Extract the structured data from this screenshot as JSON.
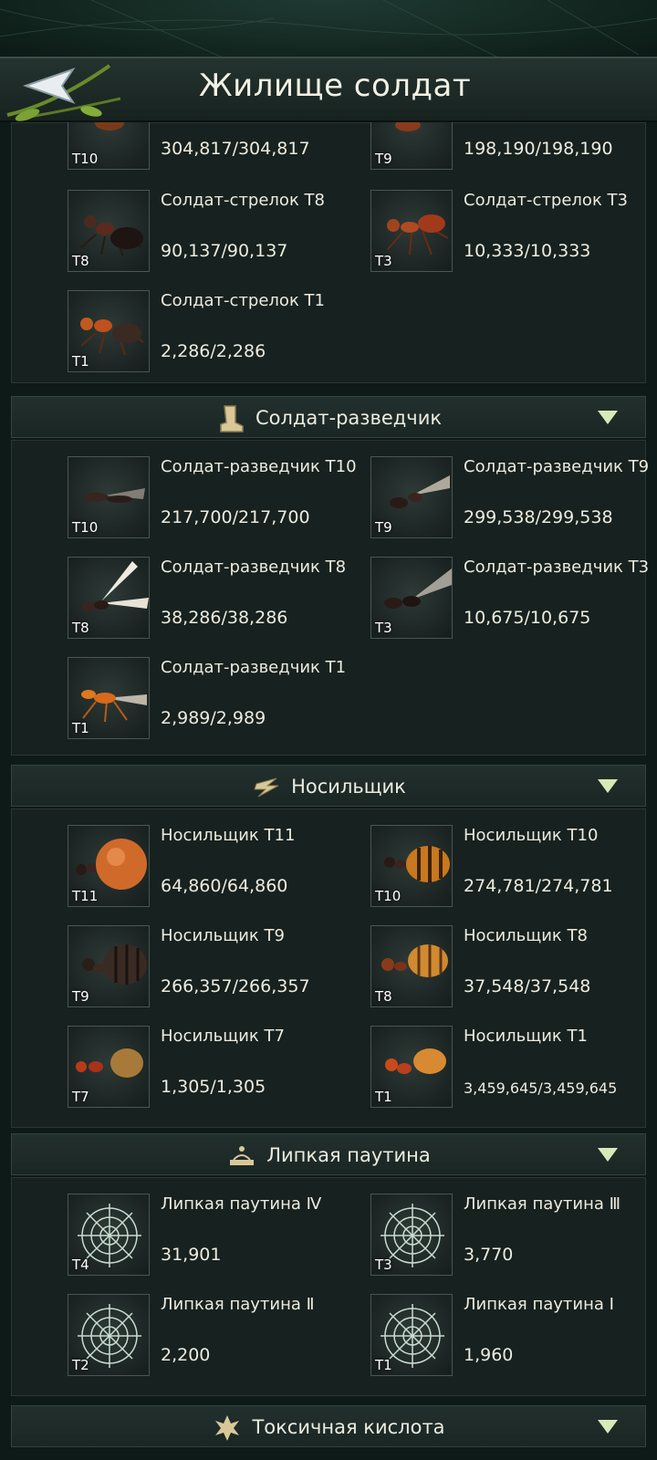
{
  "header": {
    "title": "Жилище солдат",
    "back_icon": "back-arrow-icon"
  },
  "colors": {
    "background": "#0d1a17",
    "panel": "#17211f",
    "header": "#22302d",
    "arrow": "#d8e8b8"
  },
  "archer": {
    "items": [
      {
        "name": "",
        "tier": "T10",
        "count": "304,817/304,817",
        "icon": "ant-icon"
      },
      {
        "name": "",
        "tier": "T9",
        "count": "198,190/198,190",
        "icon": "ant-icon"
      },
      {
        "name": "Солдат-стрелок Т8",
        "tier": "T8",
        "count": "90,137/90,137",
        "icon": "black-ant-icon"
      },
      {
        "name": "Солдат-стрелок Т3",
        "tier": "T3",
        "count": "10,333/10,333",
        "icon": "red-ant-icon"
      },
      {
        "name": "Солдат-стрелок Т1",
        "tier": "T1",
        "count": "2,286/2,286",
        "icon": "red-ant-icon"
      }
    ]
  },
  "scout": {
    "title": "Солдат-разведчик",
    "icon": "boot-icon",
    "items": [
      {
        "name": "Солдат-разведчик Т10",
        "tier": "T10",
        "count": "217,700/217,700",
        "icon": "winged-ant-icon"
      },
      {
        "name": "Солдат-разведчик Т9",
        "tier": "T9",
        "count": "299,538/299,538",
        "icon": "winged-ant-icon"
      },
      {
        "name": "Солдат-разведчик Т8",
        "tier": "T8",
        "count": "38,286/38,286",
        "icon": "winged-ant-icon"
      },
      {
        "name": "Солдат-разведчик Т3",
        "tier": "T3",
        "count": "10,675/10,675",
        "icon": "winged-ant-icon"
      },
      {
        "name": "Солдат-разведчик Т1",
        "tier": "T1",
        "count": "2,989/2,989",
        "icon": "winged-ant-icon"
      }
    ]
  },
  "carrier": {
    "title": "Носильщик",
    "icon": "lightning-icon",
    "items": [
      {
        "name": "Носильщик Т11",
        "tier": "T11",
        "count": "64,860/64,860",
        "icon": "honeypot-ant-icon"
      },
      {
        "name": "Носильщик Т10",
        "tier": "T10",
        "count": "274,781/274,781",
        "icon": "striped-ant-icon"
      },
      {
        "name": "Носильщик Т9",
        "tier": "T9",
        "count": "266,357/266,357",
        "icon": "dark-carrier-ant-icon"
      },
      {
        "name": "Носильщик Т8",
        "tier": "T8",
        "count": "37,548/37,548",
        "icon": "striped-ant-icon"
      },
      {
        "name": "Носильщик Т7",
        "tier": "T7",
        "count": "1,305/1,305",
        "icon": "red-ant-icon"
      },
      {
        "name": "Носильщик Т1",
        "tier": "T1",
        "count": "3,459,645/3,459,645",
        "icon": "red-ant-icon"
      }
    ]
  },
  "web": {
    "title": "Липкая паутина",
    "icon": "web-trap-icon",
    "items": [
      {
        "name": "Липкая паутина Ⅳ",
        "tier": "T4",
        "count": "31,901",
        "icon": "spider-web-icon"
      },
      {
        "name": "Липкая паутина Ⅲ",
        "tier": "T3",
        "count": "3,770",
        "icon": "spider-web-icon"
      },
      {
        "name": "Липкая паутина Ⅱ",
        "tier": "T2",
        "count": "2,200",
        "icon": "spider-web-icon"
      },
      {
        "name": "Липкая паутина Ⅰ",
        "tier": "T1",
        "count": "1,960",
        "icon": "spider-web-icon"
      }
    ]
  },
  "acid": {
    "title": "Токсичная кислота",
    "icon": "acid-icon"
  }
}
